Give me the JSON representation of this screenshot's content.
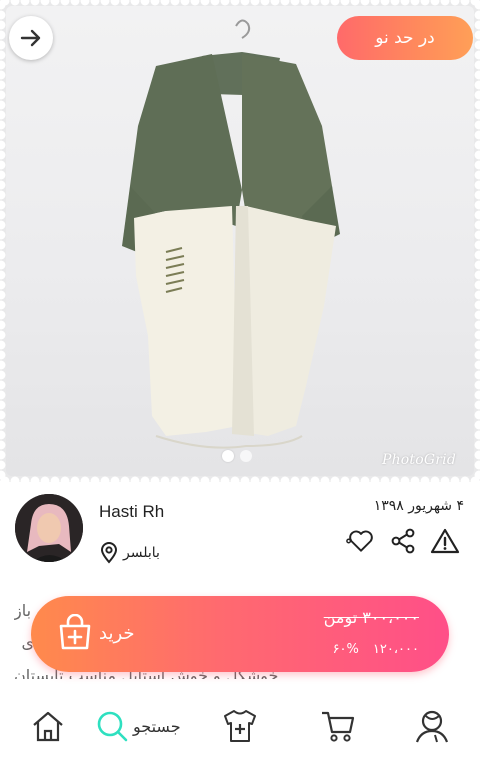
{
  "header": {
    "badge_label": "در حد نو",
    "back_icon": "arrow-right-icon"
  },
  "gallery": {
    "watermark": "PhotoGrid",
    "slide_count": 2,
    "active_slide": 1
  },
  "seller": {
    "name": "Hasti Rh",
    "city": "بابلسر",
    "date": "۴ شهریور ۱۳۹۸"
  },
  "actions": {
    "report_icon": "warning-icon",
    "share_icon": "share-icon",
    "like_icon": "heart-icon"
  },
  "description": {
    "line1": "لو باز",
    "line2": "ی",
    "line3": "خوشکل و خوش استایل مناسب تابستان"
  },
  "buy": {
    "label": "خرید",
    "old_price": "۳۰۰،۰۰۰ تومن",
    "new_price": "۱۲۰،۰۰۰",
    "discount": "۶۰%"
  },
  "nav": {
    "search_label": "جستجو"
  },
  "colors": {
    "badge_start": "#ff6a6a",
    "badge_end": "#ff9f57",
    "buy_start": "#ff8a4c",
    "buy_end": "#ff4f88",
    "search_accent": "#2ee0c0"
  }
}
